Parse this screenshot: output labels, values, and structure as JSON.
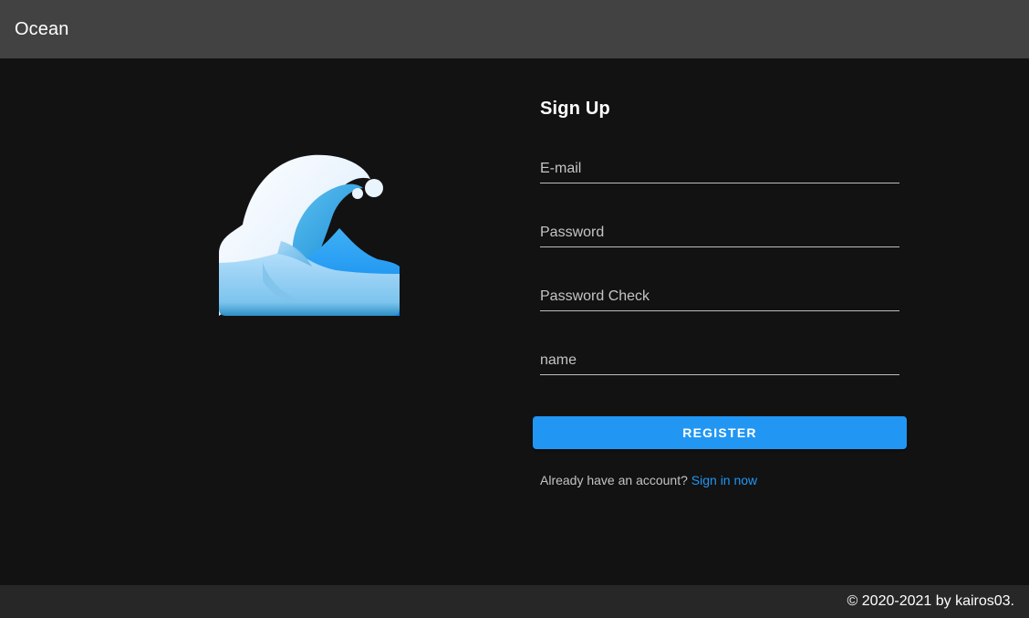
{
  "app_bar": {
    "title": "Ocean"
  },
  "logo": {
    "icon": "water-wave-icon"
  },
  "form": {
    "title": "Sign Up",
    "email": {
      "placeholder": "E-mail",
      "value": ""
    },
    "password": {
      "placeholder": "Password",
      "value": ""
    },
    "password_check": {
      "placeholder": "Password Check",
      "value": ""
    },
    "name": {
      "placeholder": "name",
      "value": ""
    },
    "register_label": "REGISTER",
    "signin_prompt": "Already have an account?",
    "signin_link": "Sign in now"
  },
  "footer": {
    "text": "© 2020-2021 by kairos03."
  },
  "colors": {
    "app_bar": "#424242",
    "background": "#121212",
    "footer": "#272727",
    "primary": "#2196f3"
  }
}
